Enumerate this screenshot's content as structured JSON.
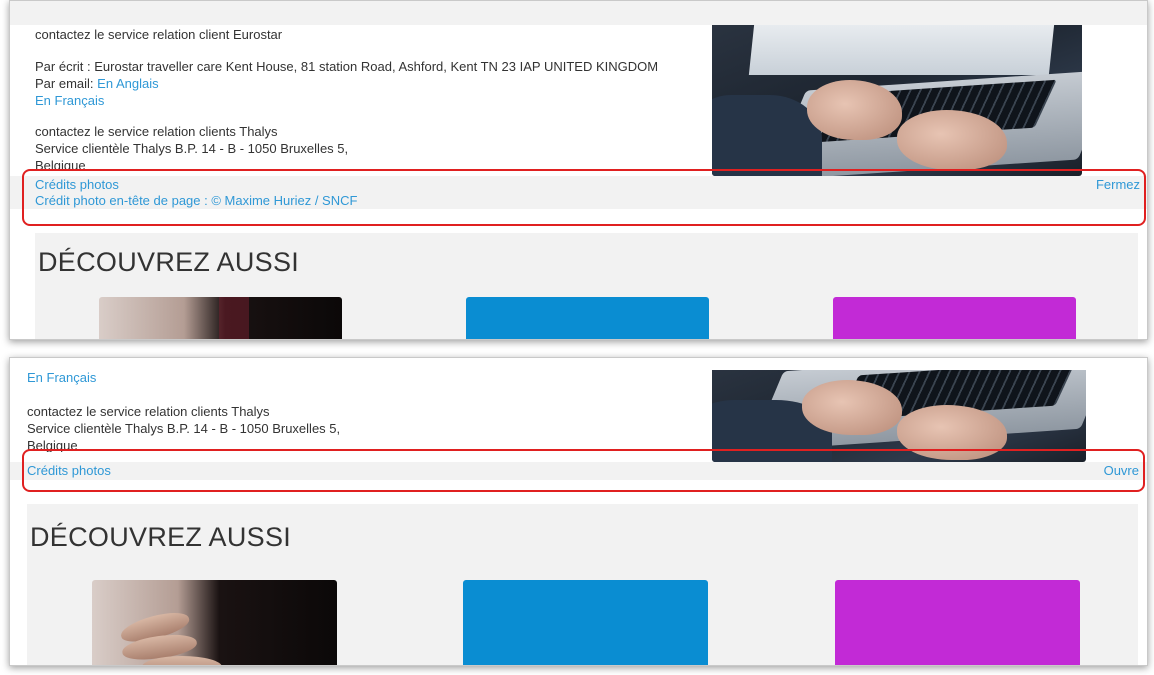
{
  "top_section": {
    "eurostar_heading": "contactez le service relation client Eurostar",
    "eurostar_address": "Par écrit : Eurostar traveller care Kent House, 81 station Road, Ashford, Kent TN 23 IAP UNITED KINGDOM",
    "email_label": "Par email:",
    "email_link_en": "En Anglais",
    "email_link_fr": "En Français",
    "thalys_heading": "contactez le service relation clients Thalys",
    "thalys_address": "Service clientèle Thalys B.P. 14 - B - 1050 Bruxelles 5,",
    "thalys_country": "Belgique",
    "credits": {
      "title": "Crédits photos",
      "header_credit": "Crédit photo en-tête de page : © Maxime Huriez / SNCF",
      "toggle": "Fermez"
    },
    "discover_title": "DÉCOUVREZ AUSSI"
  },
  "bottom_section": {
    "email_link_fr": "En Français",
    "thalys_heading": "contactez le service relation clients Thalys",
    "thalys_address": "Service clientèle Thalys B.P. 14 - B - 1050 Bruxelles 5,",
    "thalys_country": "Belgique",
    "credits": {
      "title": "Crédits photos",
      "toggle": "Ouvre"
    },
    "discover_title": "DÉCOUVREZ AUSSI"
  },
  "colors": {
    "link": "#2f98d6",
    "highlight_box": "#e02020",
    "card_blue": "#0a8dd2",
    "card_purple": "#c22ad6",
    "band_gray": "#f2f2f2"
  }
}
